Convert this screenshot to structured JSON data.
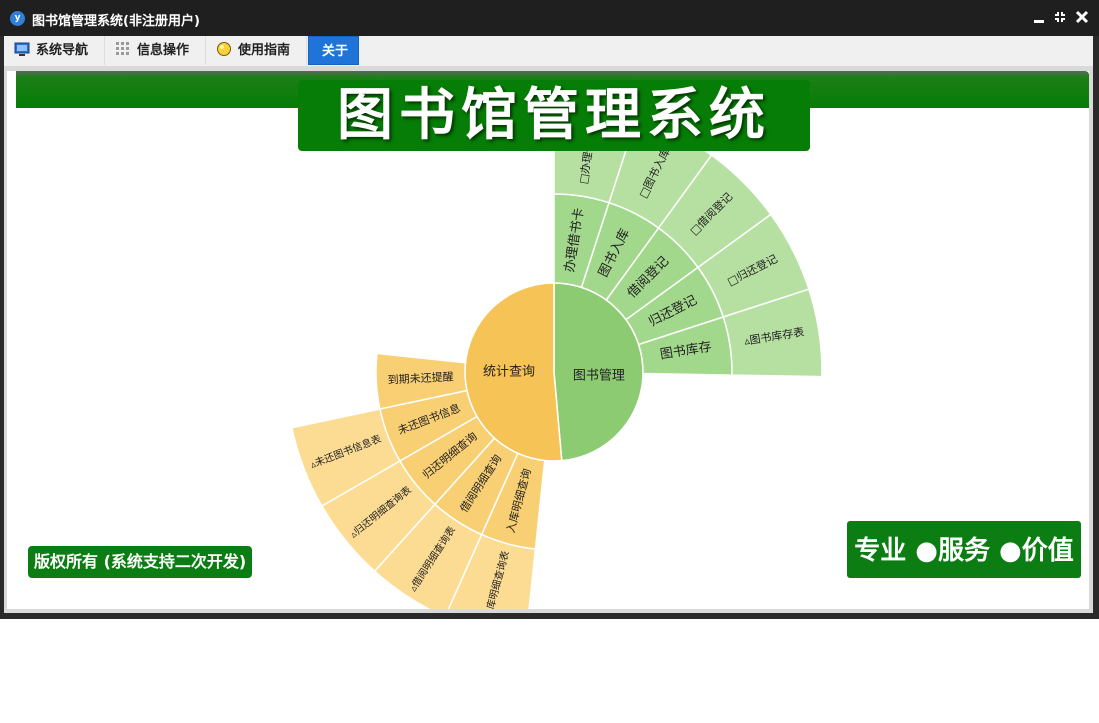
{
  "window": {
    "title": "图书馆管理系统(非注册用户)",
    "app_icon": "y"
  },
  "tabs": [
    {
      "label": "系统导航",
      "icon": "monitor-icon"
    },
    {
      "label": "信息操作",
      "icon": "grid-icon"
    },
    {
      "label": "使用指南",
      "icon": "bulb-icon"
    },
    {
      "label": "关于",
      "icon": ""
    }
  ],
  "active_tab": "关于",
  "main": {
    "system_title": "图书馆管理系统",
    "copyright": "版权所有 (系统支持二次开发)",
    "slogan": "专业 ●服务 ●价值"
  },
  "sunburst": {
    "colors": {
      "green_inner": "#8dcb72",
      "green_middle": "#a2d88b",
      "green_outer": "#b6e0a1",
      "orange_inner": "#f6c356",
      "orange_middle": "#f9cf73",
      "orange_outer": "#fcdc93"
    },
    "root": [
      {
        "label": "图书管理",
        "children": [
          {
            "label": "办理借书卡",
            "children": [
              "□办理借书卡"
            ]
          },
          {
            "label": "图书入库",
            "children": [
              "□图书入库"
            ]
          },
          {
            "label": "借阅登记",
            "children": [
              "□借阅登记"
            ]
          },
          {
            "label": "归还登记",
            "children": [
              "□归还登记"
            ]
          },
          {
            "label": "图书库存",
            "children": [
              "▵图书库存表"
            ]
          }
        ]
      },
      {
        "label": "统计查询",
        "children": [
          {
            "label": "入库明细查询",
            "children": [
              "▵入库明细查询表"
            ]
          },
          {
            "label": "借阅明细查询",
            "children": [
              "▵借阅明细查询表"
            ]
          },
          {
            "label": "归还明细查询",
            "children": [
              "▵归还明细查询表"
            ]
          },
          {
            "label": "未还图书信息",
            "children": [
              "▵未还图书信息表"
            ]
          },
          {
            "label": "到期未还提醒",
            "children": []
          }
        ]
      }
    ]
  }
}
